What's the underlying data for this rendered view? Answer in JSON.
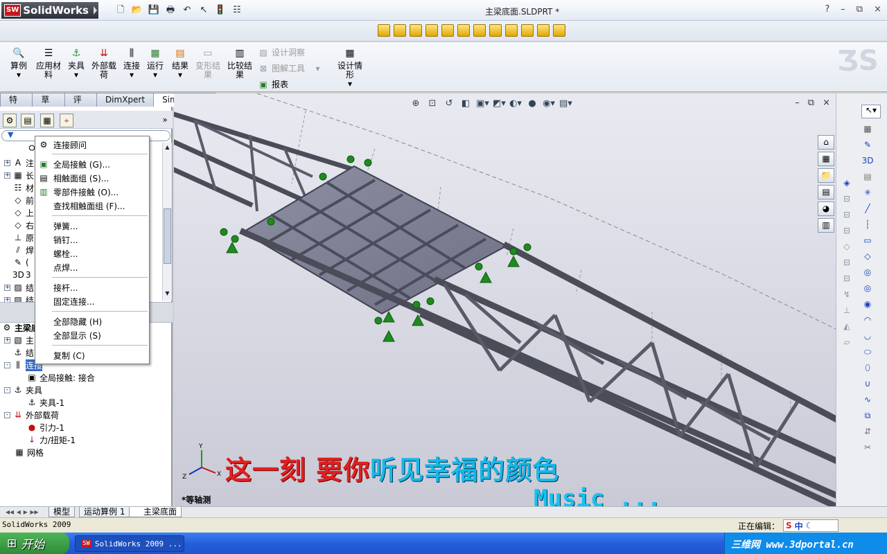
{
  "app": {
    "logo_text": "SolidWorks",
    "logo_badge": "SW",
    "window_title": "主梁底面.SLDPRT *"
  },
  "window_controls": {
    "help": "?",
    "minimize": "–",
    "restore": "⧉",
    "close": "×"
  },
  "ribbon": {
    "buttons": [
      {
        "label": "算例",
        "icon": "magnify-icon"
      },
      {
        "label": "应用材料",
        "icon": "material-icon"
      },
      {
        "label": "夹具",
        "icon": "fixture-icon"
      },
      {
        "label": "外部载荷",
        "icon": "load-icon"
      },
      {
        "label": "连接",
        "icon": "connection-icon"
      },
      {
        "label": "运行",
        "icon": "run-icon"
      },
      {
        "label": "结果",
        "icon": "results-icon"
      },
      {
        "label": "变形结果",
        "icon": "deformed-icon",
        "disabled": true
      },
      {
        "label": "比较结果",
        "icon": "compare-icon"
      },
      {
        "label": "设计情形",
        "icon": "design-scenario-icon"
      }
    ],
    "small": [
      {
        "label": "设计洞察",
        "disabled": true
      },
      {
        "label": "图解工具",
        "disabled": true
      },
      {
        "label": "报表",
        "disabled": false
      }
    ]
  },
  "tabs": [
    "特征",
    "草图",
    "评估",
    "DimXpert",
    "Simulation"
  ],
  "active_tab": "Simulation",
  "context_menu": {
    "items": [
      {
        "label": "连接顾问",
        "icon": "advisor-icon"
      },
      {
        "label": "全局接触 (G)...",
        "icon": "global-contact-icon"
      },
      {
        "label": "相触面组 (S)...",
        "icon": "contact-set-icon"
      },
      {
        "label": "零部件接触 (O)...",
        "icon": "component-contact-icon"
      },
      {
        "label": "查找相触面组 (F)...",
        "icon": ""
      },
      {
        "label": "弹簧...",
        "icon": ""
      },
      {
        "label": "销钉...",
        "icon": ""
      },
      {
        "label": "螺栓...",
        "icon": ""
      },
      {
        "label": "点焊...",
        "icon": ""
      },
      {
        "label": "接杆...",
        "icon": ""
      },
      {
        "label": "固定连接...",
        "icon": ""
      },
      {
        "label": "全部隐藏 (H)",
        "icon": ""
      },
      {
        "label": "全部显示 (S)",
        "icon": ""
      },
      {
        "label": "复制 (C)",
        "icon": ""
      }
    ]
  },
  "upper_tree": [
    "注",
    "长",
    "材",
    "前",
    "上",
    "右",
    "原",
    "焊",
    "(",
    "3",
    "结",
    "结"
  ],
  "study_tree": [
    {
      "label": "主梁底",
      "level": 0,
      "expand": ""
    },
    {
      "label": "主",
      "level": 1,
      "expand": "+"
    },
    {
      "label": "结",
      "level": 1,
      "expand": ""
    },
    {
      "label": "连接",
      "level": 1,
      "expand": "-",
      "selected": true
    },
    {
      "label": "全局接触: 接合",
      "level": 2,
      "expand": ""
    },
    {
      "label": "夹具",
      "level": 1,
      "expand": "-"
    },
    {
      "label": "夹具-1",
      "level": 2,
      "expand": ""
    },
    {
      "label": "外部载荷",
      "level": 1,
      "expand": "-"
    },
    {
      "label": "引力-1",
      "level": 2,
      "expand": ""
    },
    {
      "label": "力/扭矩-1",
      "level": 2,
      "expand": ""
    },
    {
      "label": "网格",
      "level": 1,
      "expand": ""
    }
  ],
  "viewport": {
    "view_label": "*等轴测",
    "lyric_red_1": "这一刻",
    "lyric_red_2": "要你",
    "lyric_blue": "听见幸福的颜色",
    "music": "Music ..."
  },
  "sheet_tabs": [
    "模型",
    "运动算例 1",
    "主梁底面"
  ],
  "active_sheet": "主梁底面",
  "status": {
    "left": "SolidWorks 2009",
    "right": "正在编辑：",
    "ime": "中"
  },
  "taskbar": {
    "start": "开始",
    "task": "SolidWorks 2009 ...",
    "watermark": "三维网 www.3dportal.cn"
  },
  "colors": {
    "accent": "#316ac5",
    "lyric_red": "#e02020",
    "lyric_blue": "#16b8e8",
    "ribbon_bg": "#e6ebf2"
  }
}
